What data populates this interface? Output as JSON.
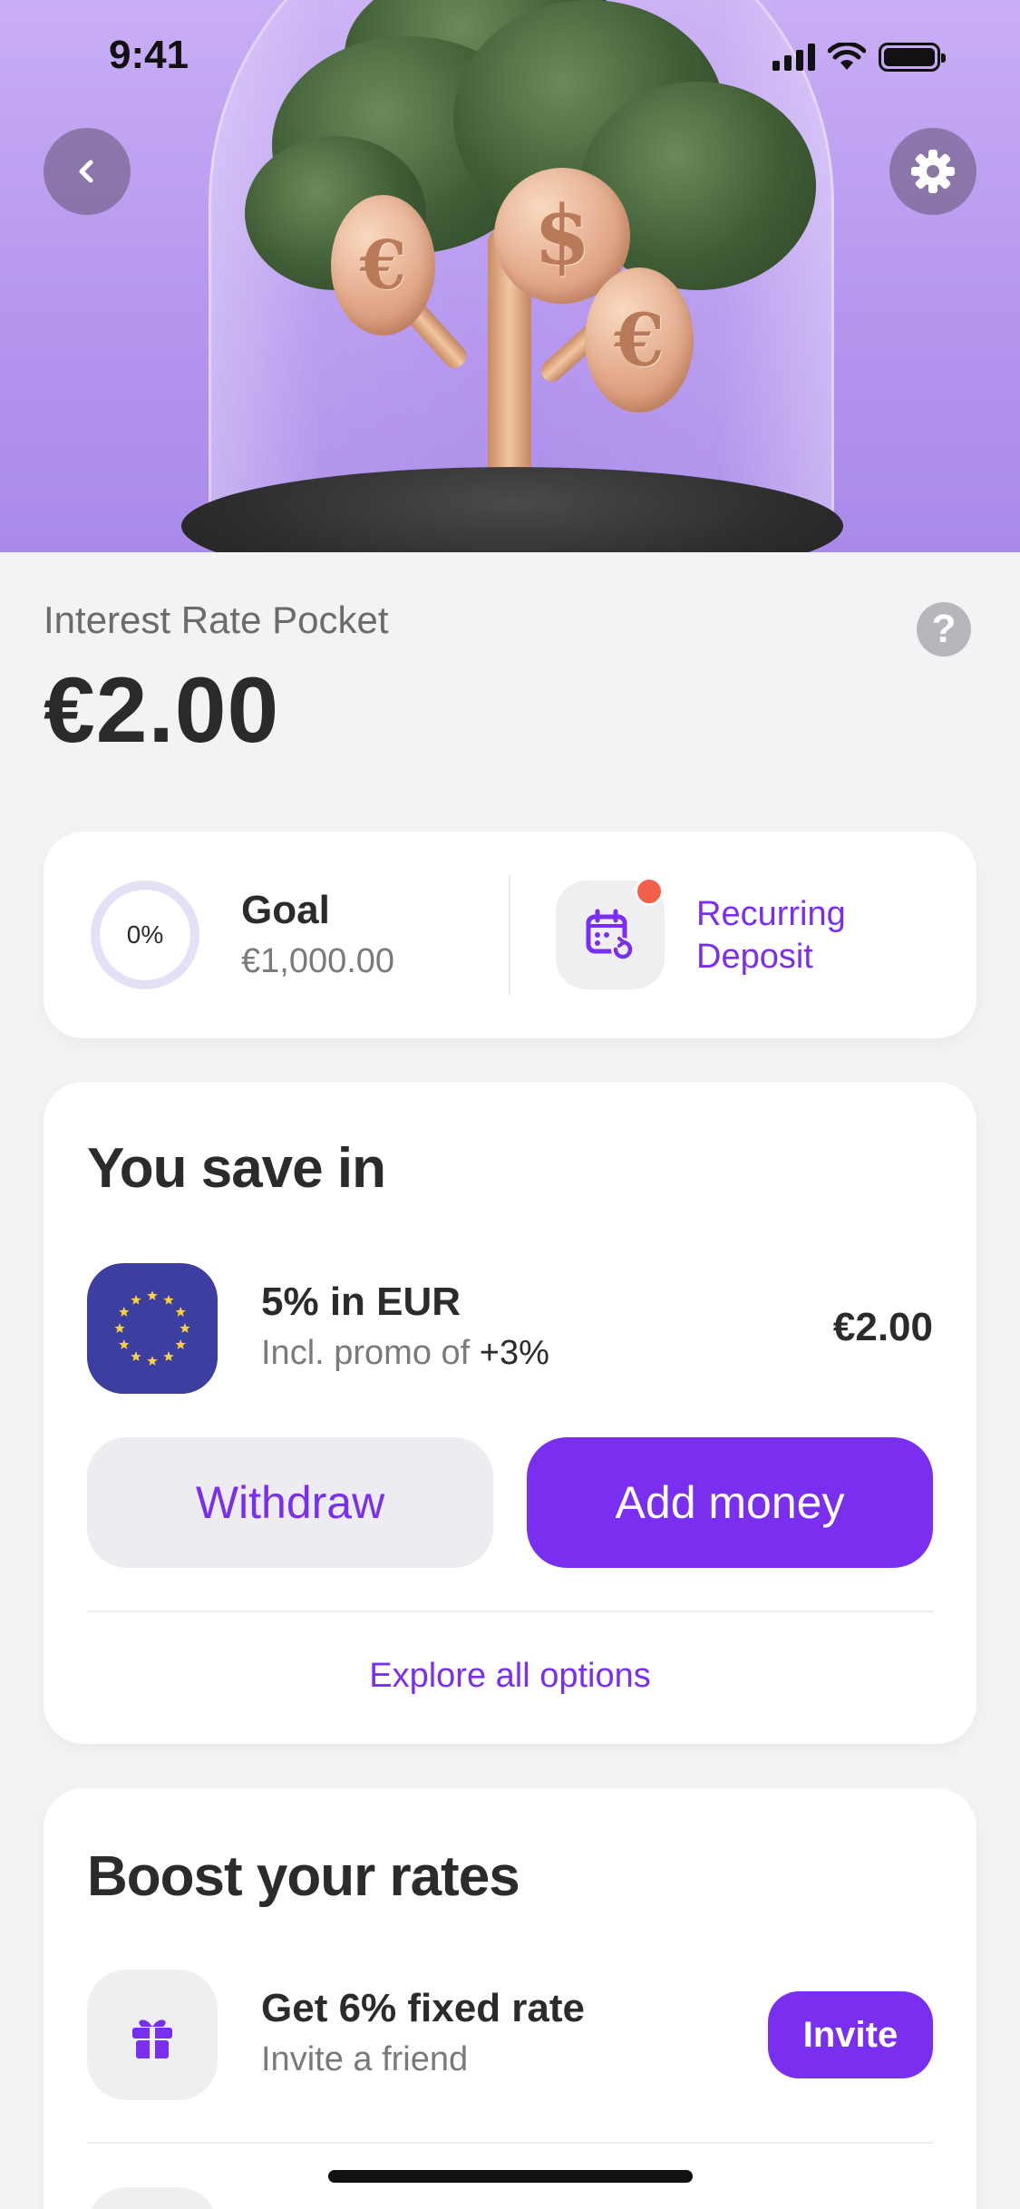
{
  "status_bar": {
    "time": "9:41"
  },
  "header": {
    "back_icon": "chevron-left-icon",
    "settings_icon": "gear-icon",
    "coin_symbols": [
      "€",
      "$",
      "€"
    ]
  },
  "pocket": {
    "title": "Interest Rate Pocket",
    "balance": "€2.00",
    "help_icon": "question-icon",
    "help_glyph": "?"
  },
  "goal": {
    "progress_label": "0%",
    "progress": 0,
    "label": "Goal",
    "amount": "€1,000.00"
  },
  "recurring": {
    "label": "Recurring Deposit",
    "icon": "calendar-repeat-icon",
    "notification_color": "#f0604a"
  },
  "save": {
    "title": "You save in",
    "currency_icon": "eu-flag-icon",
    "rate": "5% in EUR",
    "promo_prefix": "Incl. promo of",
    "promo_value": "+3%",
    "amount": "€2.00",
    "withdraw_label": "Withdraw",
    "add_label": "Add money",
    "explore_label": "Explore all options"
  },
  "boost": {
    "title": "Boost your rates",
    "offer_icon": "gift-icon",
    "offer_title": "Get 6% fixed rate",
    "offer_subtitle": "Invite a friend",
    "invite_label": "Invite"
  },
  "colors": {
    "accent": "#7a2ff0",
    "hero_bg": "#b597ef",
    "eu_blue": "#3d3fa0",
    "eu_star": "#f5d142"
  }
}
